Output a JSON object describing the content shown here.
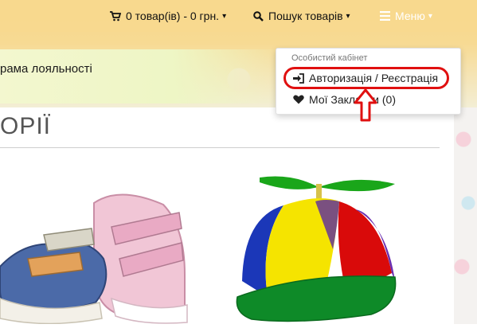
{
  "header": {
    "cart_label": "0 товар(ів) - 0 грн.",
    "search_label": "Пошук товарів",
    "menu_label": "Меню"
  },
  "banner": {
    "text": "рама лояльності"
  },
  "section": {
    "title": "ОРІЇ"
  },
  "dropdown": {
    "header": "Особистий кабінет",
    "login_label": "Авторизація / Реєстрація",
    "wishlist_label": "Мої Закладки (0)"
  },
  "colors": {
    "topbar": "#f8d98e",
    "highlight_red": "#e01010"
  },
  "icons": {
    "cart": "cart-icon",
    "search": "search-icon",
    "menu": "hamburger-icon",
    "login": "sign-in-icon",
    "wishlist": "heart-icon"
  }
}
